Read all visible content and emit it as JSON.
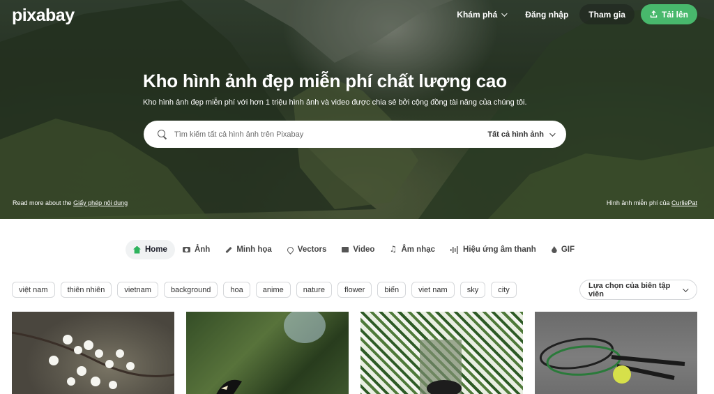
{
  "header": {
    "logo": "pixabay",
    "nav": {
      "explore": "Khám phá",
      "login": "Đăng nhập",
      "join": "Tham gia",
      "upload": "Tải lên"
    }
  },
  "hero": {
    "title": "Kho hình ảnh đẹp miễn phí chất lượng cao",
    "subtitle": "Kho hình ảnh đẹp miễn phí với hơn 1 triệu hình ảnh và video được chia sẻ bởi cộng đồng tài năng của chúng tôi.",
    "search": {
      "placeholder": "Tìm kiếm tất cả hình ảnh trên Pixabay",
      "value": "",
      "filter": "Tất cả hình ảnh"
    },
    "footer_left_text": "Read more about the",
    "footer_left_link": "Giấy phép nội dung",
    "footer_right_text": "Hình ảnh miễn phí của",
    "footer_right_link": "CurliePat"
  },
  "tabs": [
    {
      "label": "Home",
      "icon": "home-icon",
      "active": true
    },
    {
      "label": "Ảnh",
      "icon": "camera-icon"
    },
    {
      "label": "Minh họa",
      "icon": "pen-icon"
    },
    {
      "label": "Vectors",
      "icon": "vector-icon"
    },
    {
      "label": "Video",
      "icon": "video-icon"
    },
    {
      "label": "Âm nhạc",
      "icon": "music-icon"
    },
    {
      "label": "Hiệu ứng âm thanh",
      "icon": "sound-wave-icon"
    },
    {
      "label": "GIF",
      "icon": "gif-icon"
    }
  ],
  "tags": [
    "việt nam",
    "thiên nhiên",
    "vietnam",
    "background",
    "hoa",
    "anime",
    "nature",
    "flower",
    "biển",
    "viet nam",
    "sky",
    "city"
  ],
  "editor_select": "Lựa chọn của biên tập viên",
  "colors": {
    "accent_green": "#48b86c",
    "home_icon_green": "#2eb35d"
  }
}
